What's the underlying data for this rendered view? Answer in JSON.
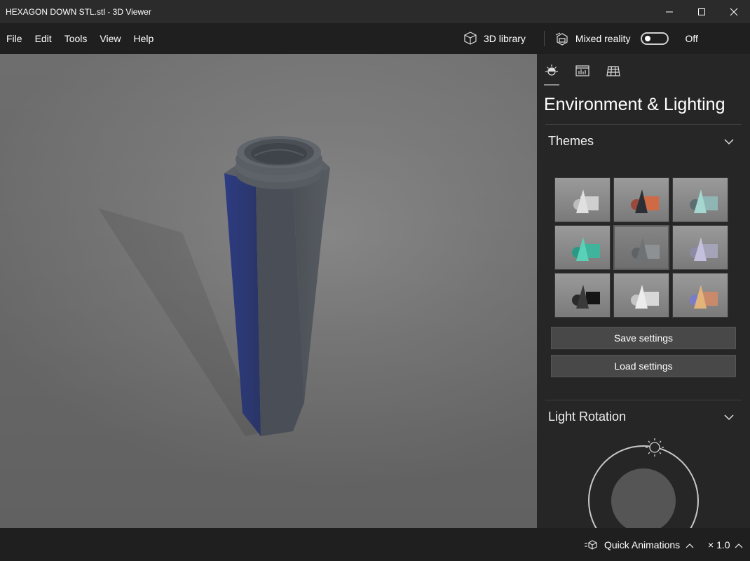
{
  "window": {
    "title": "HEXAGON DOWN STL.stl - 3D Viewer"
  },
  "menu": {
    "items": [
      "File",
      "Edit",
      "Tools",
      "View",
      "Help"
    ],
    "library_label": "3D library",
    "mixed_reality_label": "Mixed reality",
    "mixed_reality_state": "Off"
  },
  "panel": {
    "title": "Environment & Lighting",
    "tabs": [
      "sun-icon",
      "stats-icon",
      "grid-icon"
    ],
    "themes_label": "Themes",
    "save_label": "Save settings",
    "load_label": "Load settings",
    "light_rotation_label": "Light Rotation",
    "selected_theme_index": 4
  },
  "bottom": {
    "quick_animations_label": "Quick Animations",
    "speed_label": "× 1.0"
  },
  "colors": {
    "background": "#1f1f1f",
    "panel": "#262626",
    "button": "#484848",
    "model_front": "#2a3a78",
    "model_side": "#50545c"
  }
}
